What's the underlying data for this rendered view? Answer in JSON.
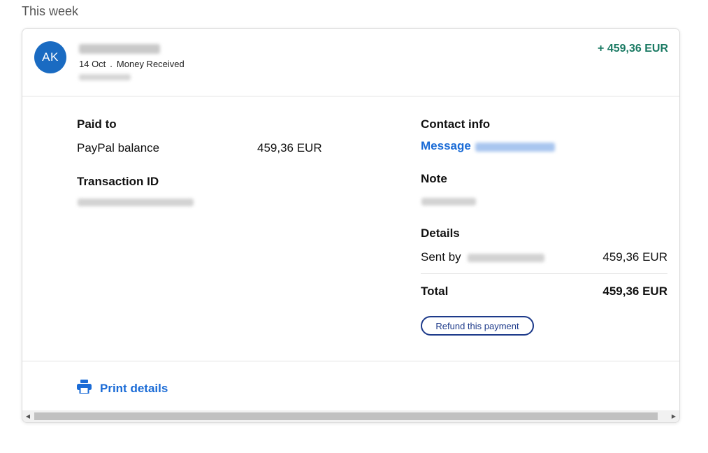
{
  "section_label": "This week",
  "transaction": {
    "avatar_initials": "AK",
    "date": "14 Oct",
    "separator": ".",
    "type": "Money Received",
    "amount": "+ 459,36 EUR",
    "amount_color": "#1a7a63"
  },
  "details": {
    "paid_to_label": "Paid to",
    "paid_to_source": "PayPal balance",
    "paid_to_amount": "459,36 EUR",
    "transaction_id_label": "Transaction ID",
    "contact_info_label": "Contact info",
    "message_link": "Message",
    "note_label": "Note",
    "details_label": "Details",
    "sent_by_label": "Sent by",
    "sent_by_amount": "459,36 EUR",
    "total_label": "Total",
    "total_amount": "459,36 EUR",
    "refund_button": "Refund this payment"
  },
  "footer": {
    "print_label": "Print details",
    "print_icon": "printer-icon"
  },
  "scrollbar": {
    "left_arrow": "◀",
    "right_arrow": "▶"
  },
  "colors": {
    "accent_blue": "#1a6bd6",
    "avatar_bg": "#1a6bc2",
    "button_navy": "#1d3a8a"
  }
}
